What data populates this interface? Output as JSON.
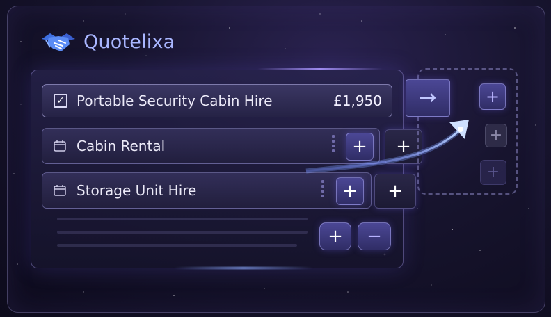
{
  "brand": {
    "name": "Quotelixa",
    "logo_icon": "handshake-icon"
  },
  "items": [
    {
      "label": "Portable Security Cabin Hire",
      "price": "£1,950",
      "checked": true
    },
    {
      "label": "Cabin Rental",
      "icon": "calendar-icon"
    },
    {
      "label": "Storage Unit Hire",
      "icon": "calendar-icon"
    }
  ],
  "controls": {
    "plus": "+",
    "minus": "−",
    "arrow": "→"
  },
  "colors": {
    "accent": "#a9b6ff",
    "button": "#4b4795",
    "background": "#17142e"
  }
}
